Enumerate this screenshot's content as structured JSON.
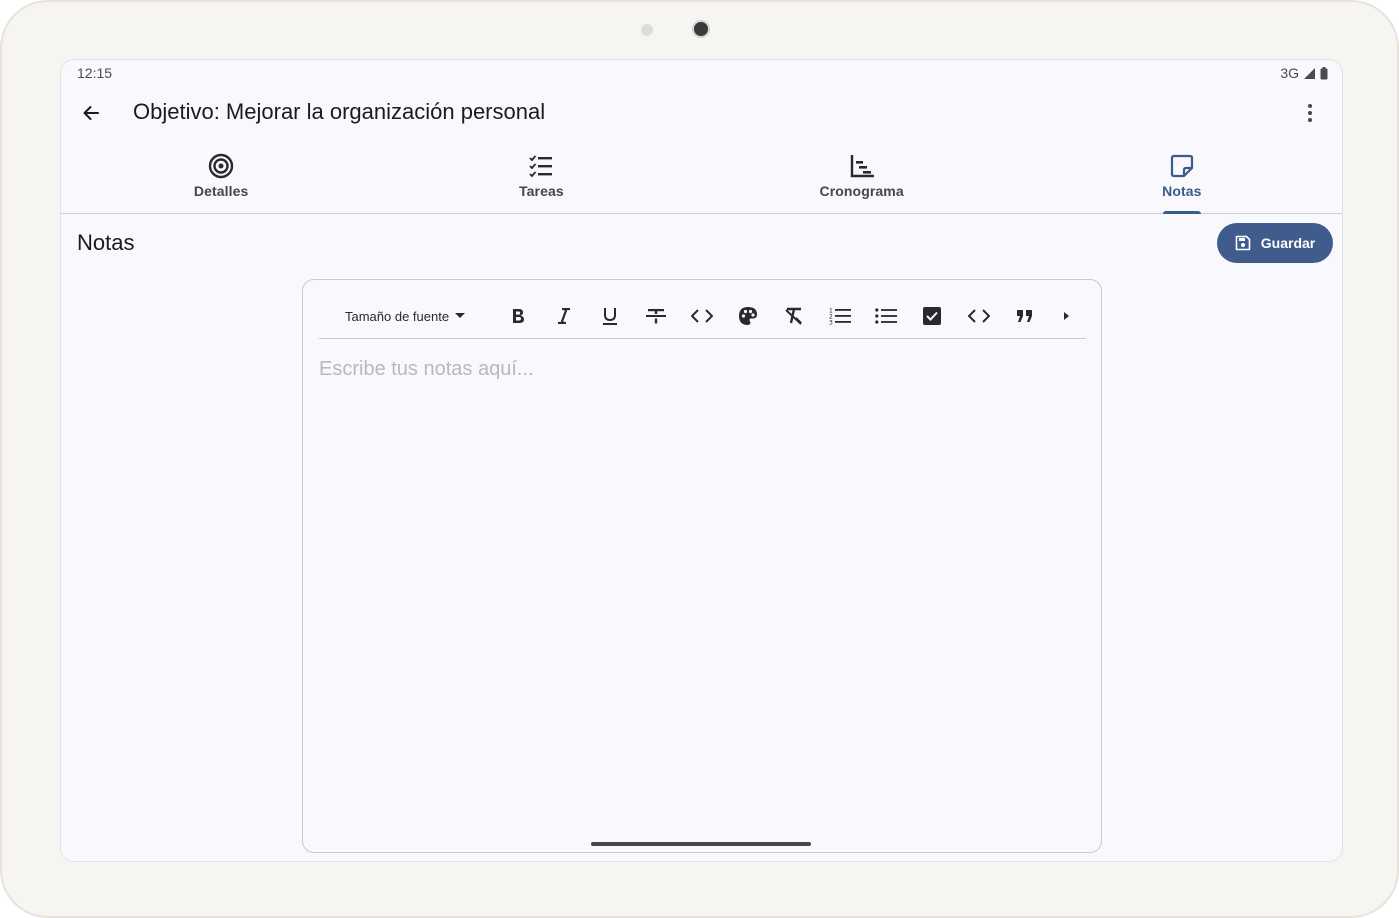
{
  "status_bar": {
    "time": "12:15",
    "network": "3G",
    "icons": [
      "signal-icon",
      "battery-icon"
    ]
  },
  "app_bar": {
    "title": "Objetivo: Mejorar la organización personal",
    "back_icon": "arrow-back-icon",
    "menu_icon": "more-vert-icon"
  },
  "tabs": [
    {
      "label": "Detalles",
      "icon": "target-icon",
      "active": false
    },
    {
      "label": "Tareas",
      "icon": "checklist-icon",
      "active": false
    },
    {
      "label": "Cronograma",
      "icon": "timeline-chart-icon",
      "active": false
    },
    {
      "label": "Notas",
      "icon": "sticky-note-icon",
      "active": true
    }
  ],
  "notes": {
    "section_title": "Notas",
    "save_label": "Guardar",
    "save_icon": "save-icon"
  },
  "editor": {
    "font_size_label": "Tamaño de fuente",
    "placeholder": "Escribe tus notas aquí...",
    "toolbar_tools": [
      "bold",
      "italic",
      "underline",
      "strikethrough",
      "inline-code",
      "color",
      "clear-format",
      "ordered-list",
      "bullet-list",
      "checklist",
      "code-block",
      "quote",
      "more"
    ]
  },
  "colors": {
    "accent": "#3b5b8c",
    "save_button": "#3f5c8c",
    "background": "#f8f8fd",
    "text_primary": "#1b1b1f",
    "placeholder": "#b8b8bf"
  }
}
